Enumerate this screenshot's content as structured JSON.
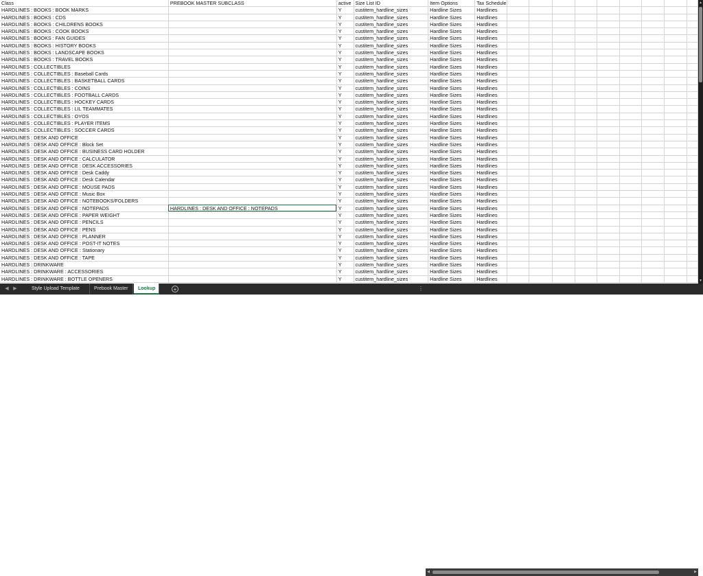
{
  "columns": [
    "Class",
    "PREBOOK MASTER SUBCLASS",
    "active",
    "Size List ID",
    "Item Options",
    "Tax Schedule",
    "",
    "",
    "",
    "",
    "",
    "",
    "",
    "",
    ""
  ],
  "rows": [
    [
      "HARDLINES : BOOKS : BOOK MARKS",
      "",
      "Y",
      "custitem_hardline_sizes",
      "Hardline Sizes",
      "Hardlines"
    ],
    [
      "HARDLINES : BOOKS : CDS",
      "",
      "Y",
      "custitem_hardline_sizes",
      "Hardline Sizes",
      "Hardlines"
    ],
    [
      "HARDLINES : BOOKS : CHILDRENS BOOKS",
      "",
      "Y",
      "custitem_hardline_sizes",
      "Hardline Sizes",
      "Hardlines"
    ],
    [
      "HARDLINES : BOOKS : COOK BOOKS",
      "",
      "Y",
      "custitem_hardline_sizes",
      "Hardline Sizes",
      "Hardlines"
    ],
    [
      "HARDLINES : BOOKS : FAN GUIDES",
      "",
      "Y",
      "custitem_hardline_sizes",
      "Hardline Sizes",
      "Hardlines"
    ],
    [
      "HARDLINES : BOOKS : HISTORY BOOKS",
      "",
      "Y",
      "custitem_hardline_sizes",
      "Hardline Sizes",
      "Hardlines"
    ],
    [
      "HARDLINES : BOOKS : LANDSCAPE BOOKS",
      "",
      "Y",
      "custitem_hardline_sizes",
      "Hardline Sizes",
      "Hardlines"
    ],
    [
      "HARDLINES : BOOKS : TRAVEL BOOKS",
      "",
      "Y",
      "custitem_hardline_sizes",
      "Hardline Sizes",
      "Hardlines"
    ],
    [
      "HARDLINES : COLLECTIBLES",
      "",
      "Y",
      "custitem_hardline_sizes",
      "Hardline Sizes",
      "Hardlines"
    ],
    [
      "HARDLINES : COLLECTIBLES : Baseball Cards",
      "",
      "Y",
      "custitem_hardline_sizes",
      "Hardline Sizes",
      "Hardlines"
    ],
    [
      "HARDLINES : COLLECTIBLES : BASKETBALL CARDS",
      "",
      "Y",
      "custitem_hardline_sizes",
      "Hardline Sizes",
      "Hardlines"
    ],
    [
      "HARDLINES : COLLECTIBLES : COINS",
      "",
      "Y",
      "custitem_hardline_sizes",
      "Hardline Sizes",
      "Hardlines"
    ],
    [
      "HARDLINES : COLLECTIBLES : FOOTBALL CARDS",
      "",
      "Y",
      "custitem_hardline_sizes",
      "Hardline Sizes",
      "Hardlines"
    ],
    [
      "HARDLINES : COLLECTIBLES : HOCKEY CARDS",
      "",
      "Y",
      "custitem_hardline_sizes",
      "Hardline Sizes",
      "Hardlines"
    ],
    [
      "HARDLINES : COLLECTIBLES : LIL TEAMMATES",
      "",
      "Y",
      "custitem_hardline_sizes",
      "Hardline Sizes",
      "Hardlines"
    ],
    [
      "HARDLINES : COLLECTIBLES : OYOS",
      "",
      "Y",
      "custitem_hardline_sizes",
      "Hardline Sizes",
      "Hardlines"
    ],
    [
      "HARDLINES : COLLECTIBLES : PLAYER ITEMS",
      "",
      "Y",
      "custitem_hardline_sizes",
      "Hardline Sizes",
      "Hardlines"
    ],
    [
      "HARDLINES : COLLECTIBLES : SOCCER CARDS",
      "",
      "Y",
      "custitem_hardline_sizes",
      "Hardline Sizes",
      "Hardlines"
    ],
    [
      "HARDLINES : DESK AND OFFICE",
      "",
      "Y",
      "custitem_hardline_sizes",
      "Hardline Sizes",
      "Hardlines"
    ],
    [
      "HARDLINES : DESK AND OFFICE : Block Set",
      "",
      "Y",
      "custitem_hardline_sizes",
      "Hardline Sizes",
      "Hardlines"
    ],
    [
      "HARDLINES : DESK AND OFFICE : BUSINESS CARD HOLDER",
      "",
      "Y",
      "custitem_hardline_sizes",
      "Hardline Sizes",
      "Hardlines"
    ],
    [
      "HARDLINES : DESK AND OFFICE : CALCULATOR",
      "",
      "Y",
      "custitem_hardline_sizes",
      "Hardline Sizes",
      "Hardlines"
    ],
    [
      "HARDLINES : DESK AND OFFICE : DESK ACCESSORIES",
      "",
      "Y",
      "custitem_hardline_sizes",
      "Hardline Sizes",
      "Hardlines"
    ],
    [
      "HARDLINES : DESK AND OFFICE : Desk Caddy",
      "",
      "Y",
      "custitem_hardline_sizes",
      "Hardline Sizes",
      "Hardlines"
    ],
    [
      "HARDLINES : DESK AND OFFICE : Desk Calendar",
      "",
      "Y",
      "custitem_hardline_sizes",
      "Hardline Sizes",
      "Hardlines"
    ],
    [
      "HARDLINES : DESK AND OFFICE : MOUSE PADS",
      "",
      "Y",
      "custitem_hardline_sizes",
      "Hardline Sizes",
      "Hardlines"
    ],
    [
      "HARDLINES : DESK AND OFFICE : Music Box",
      "",
      "Y",
      "custitem_hardline_sizes",
      "Hardline Sizes",
      "Hardlines"
    ],
    [
      "HARDLINES : DESK AND OFFICE : NOTEBOOKS/FOLDERS",
      "",
      "Y",
      "custitem_hardline_sizes",
      "Hardline Sizes",
      "Hardlines"
    ],
    [
      "HARDLINES : DESK AND OFFICE : NOTEPADS",
      "HARDLINES : DESK AND OFFICE : NOTEPADS",
      "Y",
      "custitem_hardline_sizes",
      "Hardline Sizes",
      "Hardlines"
    ],
    [
      "HARDLINES : DESK AND OFFICE : PAPER WEIGHT",
      "",
      "Y",
      "custitem_hardline_sizes",
      "Hardline Sizes",
      "Hardlines"
    ],
    [
      "HARDLINES : DESK AND OFFICE : PENCILS",
      "",
      "Y",
      "custitem_hardline_sizes",
      "Hardline Sizes",
      "Hardlines"
    ],
    [
      "HARDLINES : DESK AND OFFICE : PENS",
      "",
      "Y",
      "custitem_hardline_sizes",
      "Hardline Sizes",
      "Hardlines"
    ],
    [
      "HARDLINES : DESK AND OFFICE : PLANNER",
      "",
      "Y",
      "custitem_hardline_sizes",
      "Hardline Sizes",
      "Hardlines"
    ],
    [
      "HARDLINES : DESK AND OFFICE : POST-IT NOTES",
      "",
      "Y",
      "custitem_hardline_sizes",
      "Hardline Sizes",
      "Hardlines"
    ],
    [
      "HARDLINES : DESK AND OFFICE : Stationary",
      "",
      "Y",
      "custitem_hardline_sizes",
      "Hardline Sizes",
      "Hardlines"
    ],
    [
      "HARDLINES : DESK AND OFFICE : TAPE",
      "",
      "Y",
      "custitem_hardline_sizes",
      "Hardline Sizes",
      "Hardlines"
    ],
    [
      "HARDLINES : DRINKWARE",
      "",
      "Y",
      "custitem_hardline_sizes",
      "Hardline Sizes",
      "Hardlines"
    ],
    [
      "HARDLINES : DRINKWARE : ACCESSORIES",
      "",
      "Y",
      "custitem_hardline_sizes",
      "Hardline Sizes",
      "Hardlines"
    ],
    [
      "HARDLINES : DRINKWARE : BOTTLE OPENERS",
      "",
      "Y",
      "custitem_hardline_sizes",
      "Hardline Sizes",
      "Hardlines"
    ]
  ],
  "selected_cell": {
    "row": 28,
    "col": 1
  },
  "sheet_tabs": [
    "Style Upload Template",
    "Prebook Master",
    "Lookup"
  ],
  "active_tab": "Lookup",
  "icons": {
    "tab_prev": "triangle-left-icon",
    "tab_next": "triangle-right-icon",
    "add_sheet": "plus-circle-icon",
    "more": "vertical-dots-icon"
  },
  "colors": {
    "accent": "#217346",
    "tabbar": "#2b2b2b",
    "gridline": "#d4d4d4"
  }
}
